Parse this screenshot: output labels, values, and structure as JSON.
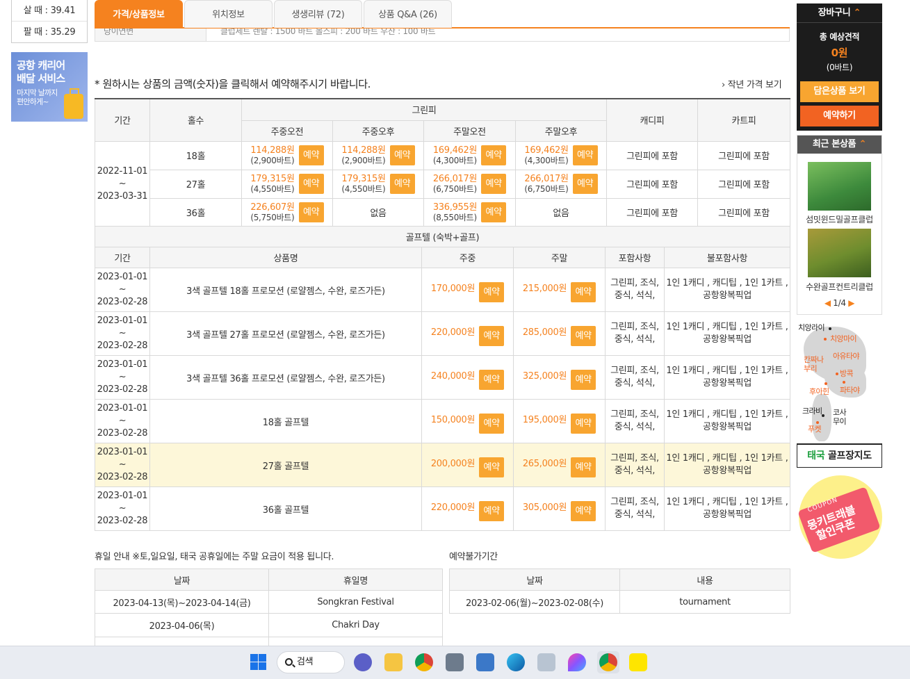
{
  "rates": {
    "buy": "살 때 : 39.41",
    "sell": "팔 때 : 35.29"
  },
  "carrier_banner": {
    "line1": "공항 캐리어",
    "line2": "배달 서비스",
    "line3": "마지막 날까지",
    "line4": "편안하게~"
  },
  "tabs": [
    "가격/상품정보",
    "위치정보",
    "생생리뷰 (72)",
    "상품 Q&A (26)"
  ],
  "partial_row": {
    "label": "당이연변",
    "text": "클럽세트 렌탈 : 1500 바트      볼스피 : 200 바트      우산 : 100 바트"
  },
  "notice": "* 원하시는 상품의 금액(숫자)을 클릭해서 예약해주시기 바랍니다.",
  "last_year_link": "작년 가격 보기",
  "greenfee": {
    "headers": {
      "period": "기간",
      "holes": "홀수",
      "green": "그린피",
      "caddie": "캐디피",
      "cart": "카트피",
      "wd_am": "주중오전",
      "wd_pm": "주중오후",
      "we_am": "주말오전",
      "we_pm": "주말오후"
    },
    "period": {
      "start": "2022-11-01",
      "sep": "~",
      "end": "2023-03-31"
    },
    "rows": [
      {
        "holes": "18홀",
        "wd_am": {
          "won": "114,288원",
          "baht": "(2,900바트)"
        },
        "wd_pm": {
          "won": "114,288원",
          "baht": "(2,900바트)"
        },
        "we_am": {
          "won": "169,462원",
          "baht": "(4,300바트)"
        },
        "we_pm": {
          "won": "169,462원",
          "baht": "(4,300바트)"
        },
        "caddie": "그린피에 포함",
        "cart": "그린피에 포함"
      },
      {
        "holes": "27홀",
        "wd_am": {
          "won": "179,315원",
          "baht": "(4,550바트)"
        },
        "wd_pm": {
          "won": "179,315원",
          "baht": "(4,550바트)"
        },
        "we_am": {
          "won": "266,017원",
          "baht": "(6,750바트)"
        },
        "we_pm": {
          "won": "266,017원",
          "baht": "(6,750바트)"
        },
        "caddie": "그린피에 포함",
        "cart": "그린피에 포함"
      },
      {
        "holes": "36홀",
        "wd_am": {
          "won": "226,607원",
          "baht": "(5,750바트)"
        },
        "wd_pm_none": "없음",
        "we_am": {
          "won": "336,955원",
          "baht": "(8,550바트)"
        },
        "we_pm_none": "없음",
        "caddie": "그린피에 포함",
        "cart": "그린피에 포함"
      }
    ],
    "reserve_label": "예약"
  },
  "golftel": {
    "title": "골프텔 (숙박+골프)",
    "headers": {
      "period": "기간",
      "name": "상품명",
      "weekday": "주중",
      "weekend": "주말",
      "incl": "포함사항",
      "excl": "불포함사항"
    },
    "rows": [
      {
        "start": "2023-01-01",
        "sep": "~",
        "end": "2023-02-28",
        "name": "3색 골프텔 18홀 프로모션 (로얄젬스, 수완, 로즈가든)",
        "weekday": "170,000원",
        "weekend": "215,000원",
        "incl": "그린피, 조식, 중식, 석식,",
        "excl1": "1인 1캐디 , 캐디팁 , 1인 1카트 ,",
        "excl2": "공항왕복픽업"
      },
      {
        "start": "2023-01-01",
        "sep": "~",
        "end": "2023-02-28",
        "name": "3색 골프텔 27홀 프로모션 (로얄젬스, 수완, 로즈가든)",
        "weekday": "220,000원",
        "weekend": "285,000원",
        "incl": "그린피, 조식, 중식, 석식,",
        "excl1": "1인 1캐디 , 캐디팁 , 1인 1카트 ,",
        "excl2": "공항왕복픽업"
      },
      {
        "start": "2023-01-01",
        "sep": "~",
        "end": "2023-02-28",
        "name": "3색 골프텔 36홀 프로모션 (로얄젬스, 수완, 로즈가든)",
        "weekday": "240,000원",
        "weekend": "325,000원",
        "incl": "그린피, 조식, 중식, 석식,",
        "excl1": "1인 1캐디 , 캐디팁 , 1인 1카트 ,",
        "excl2": "공항왕복픽업"
      },
      {
        "start": "2023-01-01",
        "sep": "~",
        "end": "2023-02-28",
        "name": "18홀 골프텔",
        "weekday": "150,000원",
        "weekend": "195,000원",
        "incl": "그린피, 조식, 중식, 석식,",
        "excl1": "1인 1캐디 , 캐디팁 , 1인 1카트 ,",
        "excl2": "공항왕복픽업"
      },
      {
        "start": "2023-01-01",
        "sep": "~",
        "end": "2023-02-28",
        "name": "27홀 골프텔",
        "weekday": "200,000원",
        "weekend": "265,000원",
        "incl": "그린피, 조식, 중식, 석식,",
        "excl1": "1인 1캐디 , 캐디팁 , 1인 1카트 ,",
        "excl2": "공항왕복픽업"
      },
      {
        "start": "2023-01-01",
        "sep": "~",
        "end": "2023-02-28",
        "name": "36홀 골프텔",
        "weekday": "220,000원",
        "weekend": "305,000원",
        "incl": "그린피, 조식, 중식, 석식,",
        "excl1": "1인 1캐디 , 캐디팁 , 1인 1카트 ,",
        "excl2": "공항왕복픽업"
      }
    ]
  },
  "holiday": {
    "title": "휴일 안내 ※토,일요일, 태국 공휴일에는 주말 요금이 적용 됩니다.",
    "headers": {
      "date": "날짜",
      "name": "휴일명"
    },
    "rows": [
      {
        "date": "2023-04-13(목)~2023-04-14(금)",
        "name": "Songkran Festival"
      },
      {
        "date": "2023-04-06(목)",
        "name": "Chakri Day"
      }
    ]
  },
  "blocked": {
    "title": "예약불가기간",
    "headers": {
      "date": "날짜",
      "content": "내용"
    },
    "rows": [
      {
        "date": "2023-02-06(월)~2023-02-08(수)",
        "content": "tournament"
      }
    ]
  },
  "cart": {
    "title": "장바구니",
    "estimate": "총 예상견적",
    "amount": "0원",
    "baht": "(0바트)",
    "saved_btn": "담은상품 보기",
    "book_btn": "예약하기"
  },
  "recent": {
    "title": "최근 본상품",
    "items": [
      "섬밋윈드밀골프클럽",
      "수완골프컨트리클럽"
    ],
    "pager": "1/4"
  },
  "map": {
    "labels": [
      "치앙라이",
      "치앙마이",
      "칸짜나",
      "부리",
      "아유타야",
      "방콕",
      "후아힌",
      "파타야",
      "크라비",
      "코사",
      "무이",
      "푸켓"
    ],
    "title_accent": "태국",
    "title_rest": " 골프장지도"
  },
  "coupon": {
    "small": "COUPON",
    "line1": "몽키트래블",
    "line2": "할인쿠폰"
  },
  "taskbar": {
    "search": "검색"
  },
  "colors": {
    "accent": "#f5821f",
    "button": "#f8a530",
    "book": "#f26322",
    "highlight_row": "#fdf7d9"
  }
}
